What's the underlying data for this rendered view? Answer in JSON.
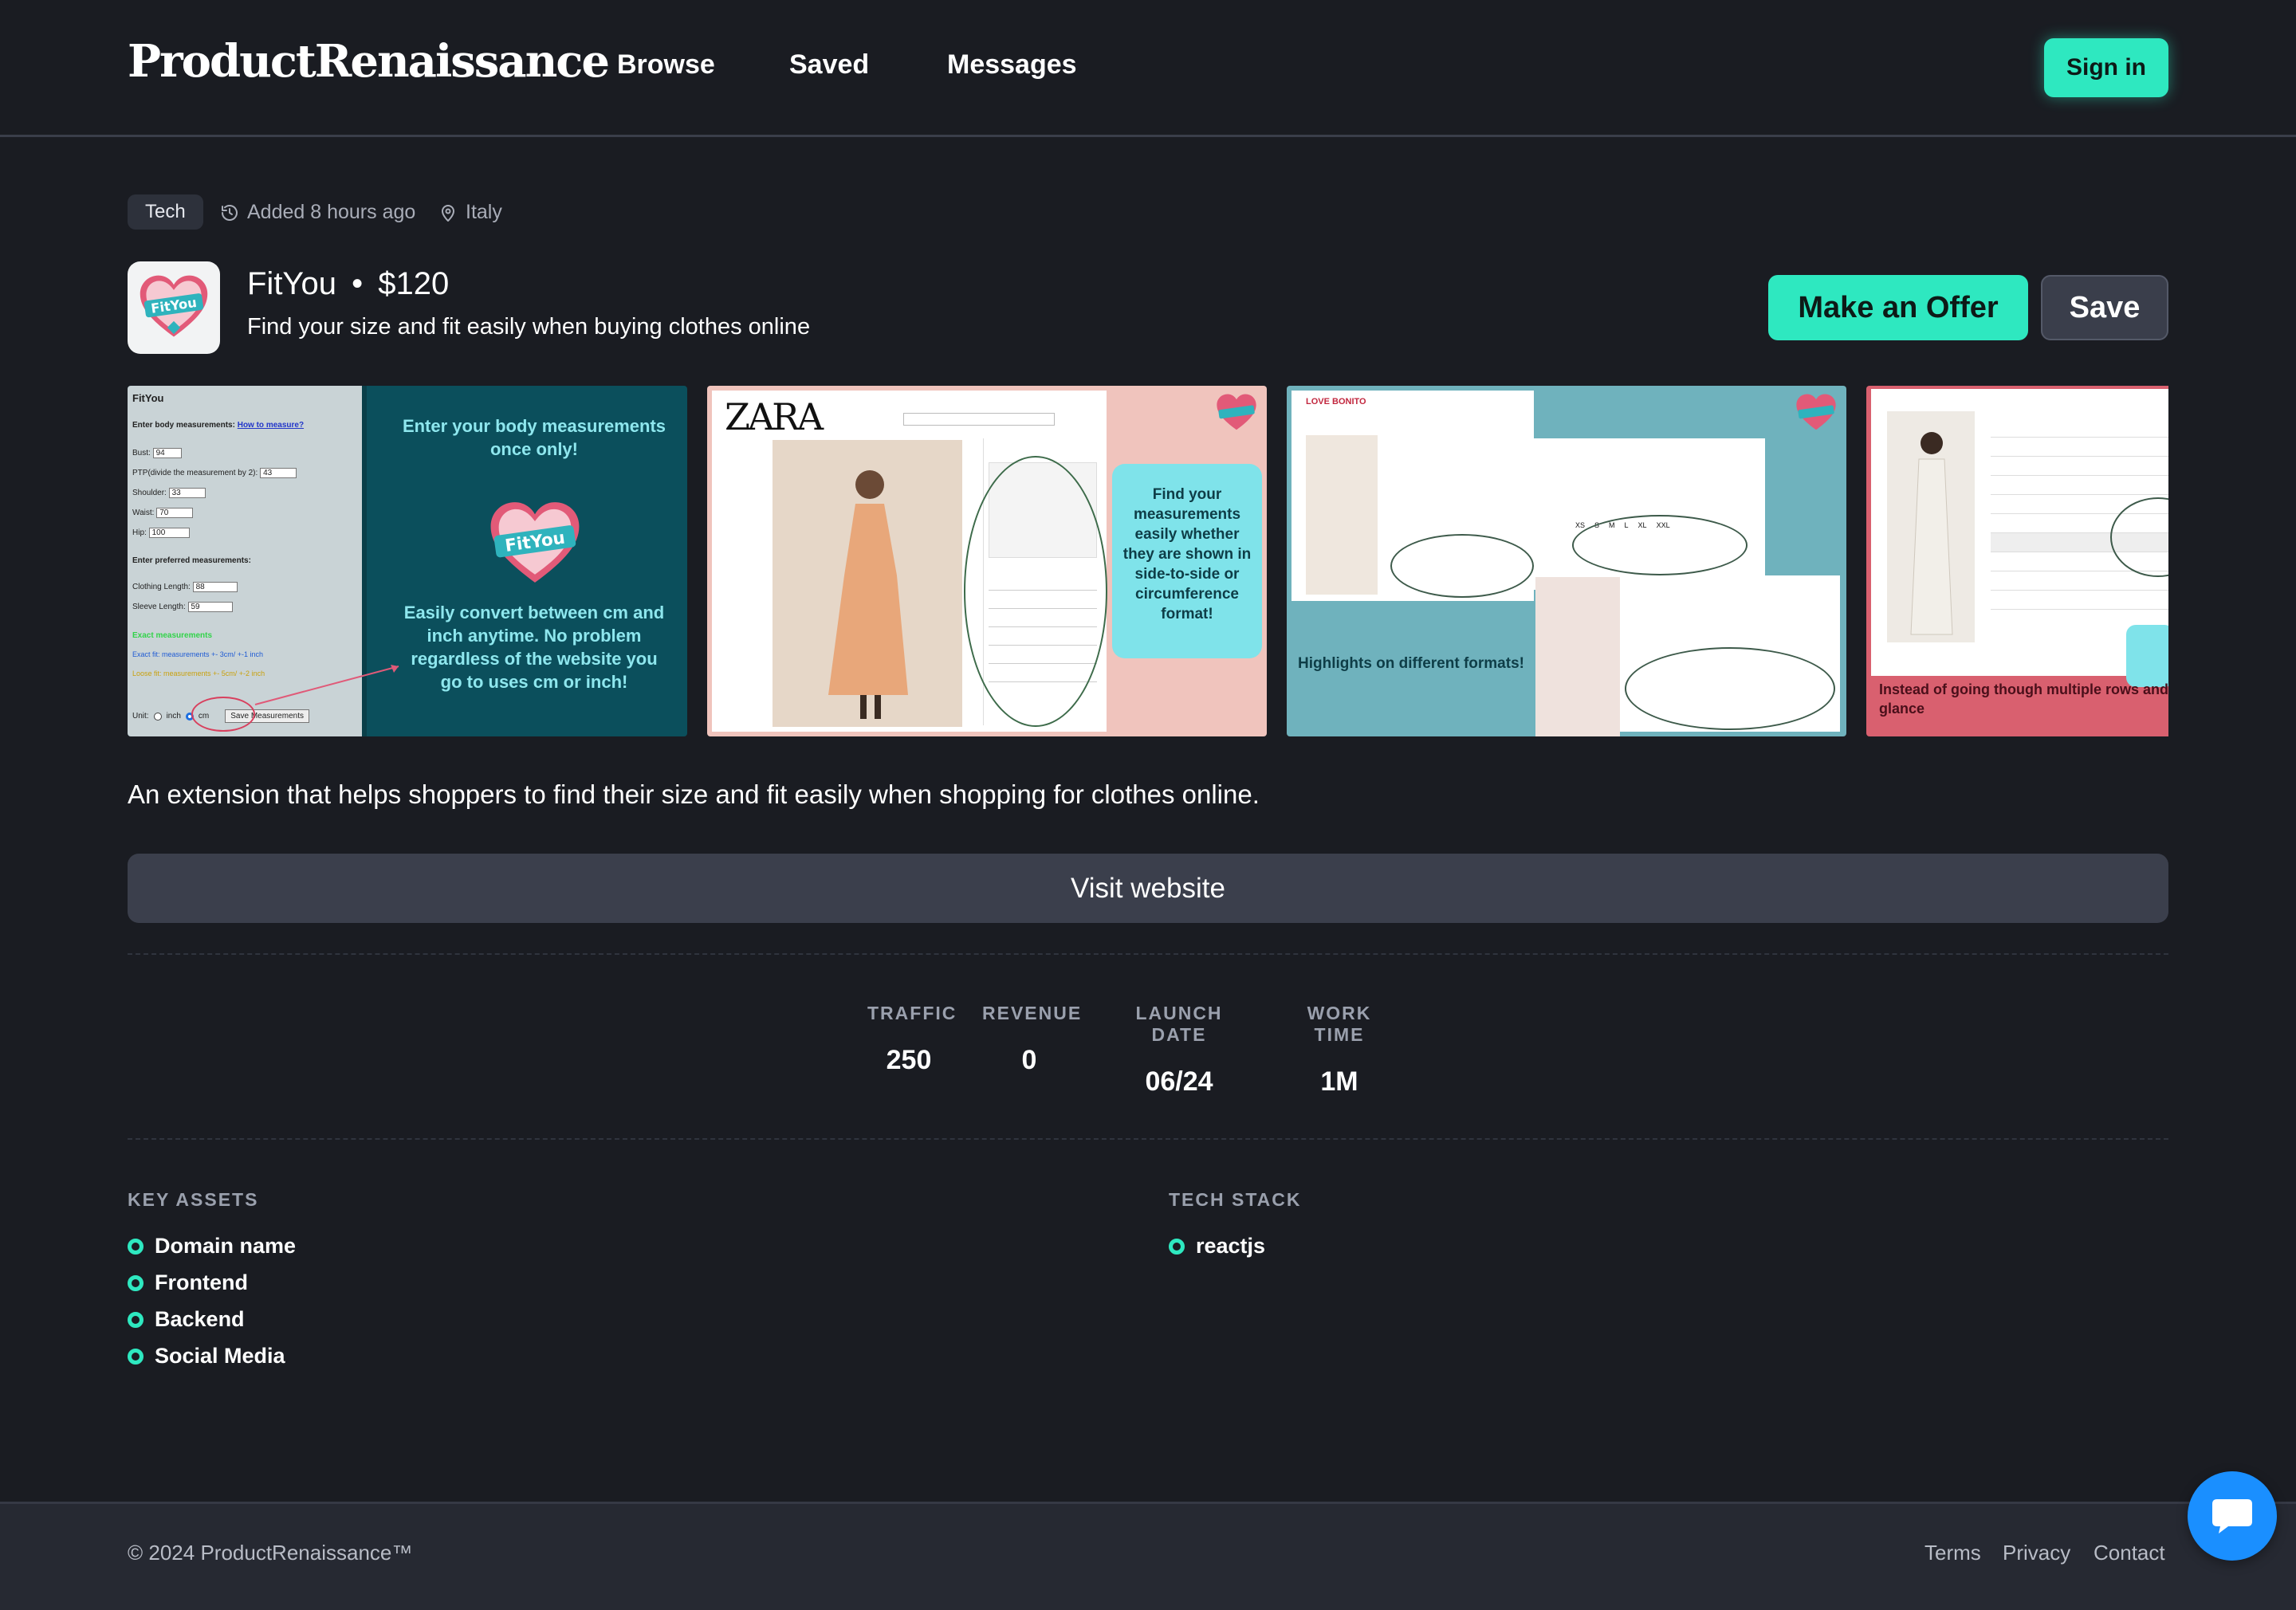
{
  "header": {
    "logo": "ProductRenaissance",
    "nav": [
      "Browse",
      "Saved",
      "Messages"
    ],
    "signin_label": "Sign in"
  },
  "listing": {
    "category": "Tech",
    "added": "Added 8 hours ago",
    "location": "Italy",
    "name": "FitYou",
    "separator": "•",
    "price": "$120",
    "tagline": "Find your size and fit easily when buying clothes online",
    "offer_label": "Make an Offer",
    "save_label": "Save",
    "description": "An extension that helps shoppers to find their size and fit easily when shopping for clothes online.",
    "visit_label": "Visit website"
  },
  "gallery": {
    "shot1": {
      "panel_title": "FitYou",
      "enter_label": "Enter body measurements:",
      "how_link": "How to measure?",
      "fields": [
        {
          "label": "Bust:",
          "value": "94"
        },
        {
          "label": "PTP(divide the measurement by 2):",
          "value": "43"
        },
        {
          "label": "Shoulder:",
          "value": "33"
        },
        {
          "label": "Waist:",
          "value": "70"
        },
        {
          "label": "Hip:",
          "value": "100"
        }
      ],
      "preferred_label": "Enter preferred measurements:",
      "pref_fields": [
        {
          "label": "Clothing Length:",
          "value": "88"
        },
        {
          "label": "Sleeve Length:",
          "value": "59"
        }
      ],
      "exact_label": "Exact measurements",
      "exact_fit": "Exact fit: measurements +- 3cm/ +-1 inch",
      "loose_fit": "Loose fit: measurements +- 5cm/ +-2 inch",
      "unit_label": "Unit:",
      "unit_inch": "inch",
      "unit_cm": "cm",
      "save_measurements": "Save Measurements",
      "headline": "Enter your body measurements once only!",
      "badge": "FitYou",
      "convert_text": "Easily convert between cm and inch anytime. No problem regardless of the website you go to uses cm or inch!"
    },
    "shot2": {
      "brand": "ZARA",
      "callout": "Find your measurements easily whether they are shown in side-to-side or circumference format!"
    },
    "shot3": {
      "brand": "LOVE BONITO",
      "caption": "Highlights on different formats!",
      "sizes": [
        "XS",
        "S",
        "M",
        "L",
        "XL",
        "XXL"
      ]
    },
    "shot4": {
      "caption": "Instead of going though multiple rows and columns, See which size Fit You at a glance"
    }
  },
  "stats": [
    {
      "label": "TRAFFIC",
      "value": "250"
    },
    {
      "label": "REVENUE",
      "value": "0"
    },
    {
      "label": "LAUNCH DATE",
      "value": "06/24"
    },
    {
      "label": "WORK TIME",
      "value": "1M"
    }
  ],
  "assets": {
    "title": "KEY ASSETS",
    "items": [
      "Domain name",
      "Frontend",
      "Backend",
      "Social Media"
    ]
  },
  "tech": {
    "title": "TECH STACK",
    "items": [
      "reactjs"
    ]
  },
  "footer": {
    "copyright": "© 2024 ProductRenaissance™",
    "links": [
      "Terms",
      "Privacy",
      "Contact"
    ]
  },
  "colors": {
    "background": "#1a1c22",
    "accent": "#2ee8c0",
    "chat": "#1a8fff"
  }
}
